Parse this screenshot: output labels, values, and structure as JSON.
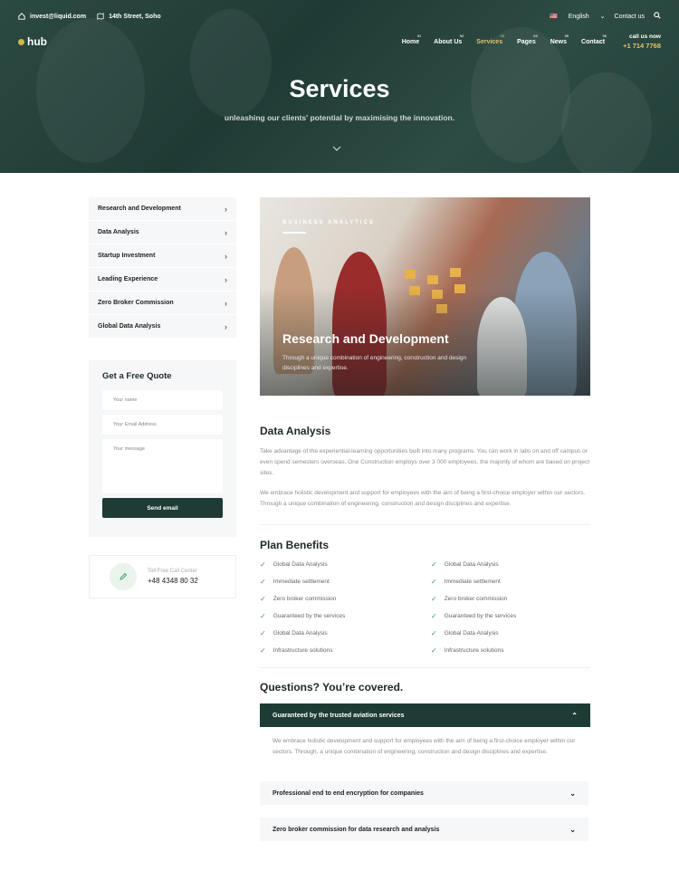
{
  "topbar": {
    "email": "invest@liquid.com",
    "address": "14th Street, Soho",
    "language": "English",
    "contact": "Contact us"
  },
  "nav": {
    "logo": "hub",
    "items": [
      {
        "label": "Home",
        "num": "01"
      },
      {
        "label": "About Us",
        "num": "02"
      },
      {
        "label": "Services",
        "num": "03"
      },
      {
        "label": "Pages",
        "num": "04"
      },
      {
        "label": "News",
        "num": "05"
      },
      {
        "label": "Contact",
        "num": "06"
      }
    ],
    "call_label": "call us now",
    "call_number": "+1 714 7768"
  },
  "hero": {
    "title": "Services",
    "subtitle": "unleashing our clients' potential by maximising the innovation."
  },
  "sidebar": {
    "items": [
      "Research and Development",
      "Data Analysis",
      "Startup Investment",
      "Leading Experience",
      "Zero Broker Commission",
      "Global Data Analysis"
    ]
  },
  "quote": {
    "title": "Get a Free Quote",
    "name_placeholder": "Your name",
    "email_placeholder": "Your Email Address",
    "message_placeholder": "Your message",
    "button": "Send email"
  },
  "tollfree": {
    "label": "Toll Free Call Center",
    "number": "+48 4348 80 32"
  },
  "feature": {
    "kicker": "BUSINESS ANALYTICS",
    "title": "Research and Development",
    "text": "Through a unique combination of engineering, construction and design disciplines and expertise."
  },
  "analysis": {
    "title": "Data Analysis",
    "p1": "Take advantage of the experiential-learning opportunities built into many programs. You can work in labs on and off campus or even spend semesters overseas. One Construction employs over 3 000 employees, the majority of whom are based on project sites.",
    "p2": "We embrace holistic development and support for employees with the aim of being a first-choice employer within our sectors. Through a unique combination of engineering, construction and design disciplines and expertise."
  },
  "benefits": {
    "title": "Plan Benefits",
    "items": [
      "Global Data Analysis",
      "Global Data Analysis",
      "Immediate settlement",
      "Immediate settlement",
      "Zero broker commission",
      "Zero broker commission",
      "Guaranteed by the services",
      "Guaranteed by the services",
      "Global Data Analysis",
      "Global Data Analysis",
      "Infrastructure solutions",
      "Infrastructure solutions"
    ]
  },
  "faq": {
    "title": "Questions? You’re covered.",
    "open_q": "Guaranteed by the trusted aviation services",
    "open_a": "We embrace holistic development and support for employees with the aim of being a first-choice employer within our sectors. Through, a unique combination of engineering, construction and design disciplines and expertise.",
    "q2": "Professional end to end encryption for companies",
    "q3": "Zero broker commission for data research and analysis"
  },
  "colors": {
    "primary": "#1e3b35",
    "accent": "#e3c36b",
    "check": "#3aa05c"
  }
}
